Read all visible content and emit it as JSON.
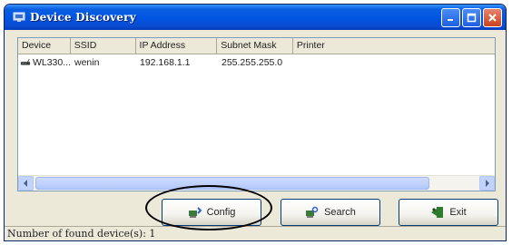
{
  "window": {
    "title": "Device Discovery"
  },
  "device_list": {
    "columns": [
      "Device",
      "SSID",
      "IP Address",
      "Subnet Mask",
      "Printer"
    ],
    "rows": [
      [
        "WL330...",
        "wenin",
        "192.168.1.1",
        "255.255.255.0",
        ""
      ]
    ]
  },
  "buttons": {
    "config": "Config",
    "search": "Search",
    "exit": "Exit"
  },
  "status": {
    "text": "Number of found device(s): 1"
  }
}
